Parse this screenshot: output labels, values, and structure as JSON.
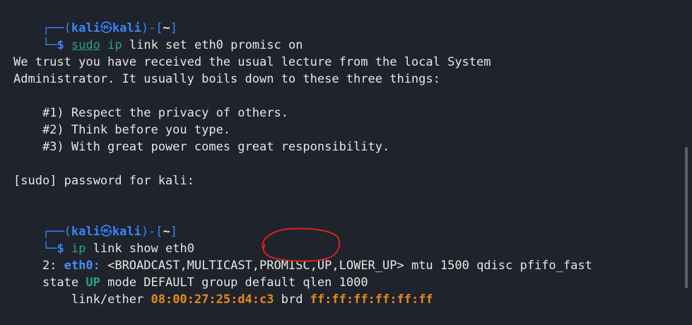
{
  "prompt1": {
    "box_top": "┌──(",
    "user": "kali",
    "skull": "㉿",
    "host": "kali",
    "close": ")-[",
    "path": "~",
    "end": "]",
    "box_bottom": "└─",
    "dollar": "$",
    "cmd_word1": "sudo",
    "cmd_word2": "ip",
    "cmd_rest": " link set eth0 promisc on"
  },
  "lecture": {
    "line1": "We trust you have received the usual lecture from the local System",
    "line2": "Administrator. It usually boils down to these three things:",
    "item1": "    #1) Respect the privacy of others.",
    "item2": "    #2) Think before you type.",
    "item3": "    #3) With great power comes great responsibility.",
    "password": "[sudo] password for kali:"
  },
  "prompt2": {
    "box_top": "┌──(",
    "user": "kali",
    "skull": "㉿",
    "host": "kali",
    "close": ")-[",
    "path": "~",
    "end": "]",
    "box_bottom": "└─",
    "dollar": "$",
    "cmd_word1": "ip",
    "cmd_rest": " link show eth0"
  },
  "output": {
    "idx": "2: ",
    "iface": "eth0:",
    "flags": " <BROADCAST,MULTICAST,PROMISC,UP,LOWER_UP> mtu 1500 qdisc pfifo_fast",
    "state_pre": "state ",
    "state": "UP",
    "state_post": " mode DEFAULT group default qlen 1000",
    "link_pre": "    link/ether ",
    "mac": "08:00:27:25:d4:c3",
    "brd": " brd ",
    "brd_addr": "ff:ff:ff:ff:ff:ff"
  },
  "colors": {
    "background": "#1f232b",
    "prompt_blue": "#3a84ff",
    "command_green": "#2aa18c",
    "mac_orange": "#e68a1c",
    "annotation_red": "#e0201e"
  },
  "annotation": {
    "circle_target": "PROMISC"
  }
}
